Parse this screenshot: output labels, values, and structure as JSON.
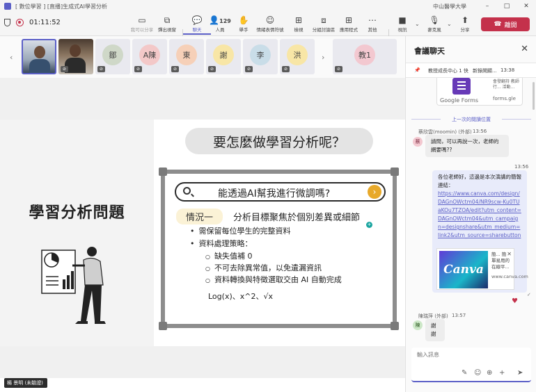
{
  "window": {
    "title": "[ 數位學習 ] [直播]生成式AI學習分析",
    "org": "中山醫學大學",
    "controls": [
      "–",
      "□",
      "✕"
    ]
  },
  "toolbar": {
    "timer": "01:11:52",
    "buttons": [
      {
        "id": "dont-disturb",
        "label": "我可以分享",
        "icon": "▭"
      },
      {
        "id": "popout",
        "label": "彈出視窗",
        "icon": "⧉"
      },
      {
        "id": "chat",
        "label": "聊天",
        "icon": "💬"
      },
      {
        "id": "people",
        "label": "人員",
        "icon": "👤",
        "count": "129"
      },
      {
        "id": "raise",
        "label": "舉手",
        "icon": "✋"
      },
      {
        "id": "react",
        "label": "情緒表情符號",
        "icon": "☺"
      },
      {
        "id": "view",
        "label": "檢視",
        "icon": "⊞"
      },
      {
        "id": "breakout",
        "label": "分組討論區",
        "icon": "⧈"
      },
      {
        "id": "apps",
        "label": "應用程式",
        "icon": "⊞"
      },
      {
        "id": "more",
        "label": "其他",
        "icon": "⋯"
      },
      {
        "id": "camera",
        "label": "視訊",
        "icon": "■"
      },
      {
        "id": "mic",
        "label": "麥克風",
        "icon": "🎙"
      },
      {
        "id": "share",
        "label": "分享",
        "icon": "⬆"
      }
    ],
    "leave_label": "離開"
  },
  "participants": [
    {
      "type": "video",
      "name": "video-participant-1"
    },
    {
      "type": "video",
      "name": "video-participant-2"
    },
    {
      "type": "avatar",
      "initials": "鄒",
      "color": "#cfd8c8"
    },
    {
      "type": "avatar",
      "initials": "A陳",
      "color": "#f3c8c8"
    },
    {
      "type": "avatar",
      "initials": "東",
      "color": "#f6d0b8"
    },
    {
      "type": "avatar",
      "initials": "謝",
      "color": "#f8e6a6"
    },
    {
      "type": "avatar",
      "initials": "李",
      "color": "#c9dde8"
    },
    {
      "type": "avatar",
      "initials": "洪",
      "color": "#f8e6a6"
    },
    {
      "type": "avatar",
      "initials": "教1",
      "color": "#f3c8d0"
    }
  ],
  "slide": {
    "left_heading": "學習分析問題",
    "question": "要怎麼做學習分析呢？",
    "search_text": "能透過AI幫我進行微調嗎?",
    "case_label": "情況一",
    "case_text": "分析目標聚焦於個別差異或細節",
    "bullets": [
      {
        "level": 1,
        "text": "需保留每位學生的完整資料"
      },
      {
        "level": 1,
        "text": "資料處理策略："
      },
      {
        "level": 2,
        "text": "缺失值補 0"
      },
      {
        "level": 2,
        "text": "不可去除異常值，以免遺漏資訊"
      },
      {
        "level": 2,
        "text": "資料轉換與特徵選取交由 AI 自動完成"
      }
    ],
    "formula": "Log(x)、x^2、√x"
  },
  "presenter_tag": "楊 景明 (未驗證)",
  "chat": {
    "title": "會議聊天",
    "close": "✕",
    "pinned": {
      "from": "教授成長中心 1 快",
      "text": "新錄開顯...",
      "time": "13:38"
    },
    "forms_card": {
      "brand": "Google Forms",
      "desc": "會發翻持 教師行... 活動...",
      "url": "forms.gle"
    },
    "last_read": "上一次的閱讀位置",
    "messages": [
      {
        "author": "蔡欣雲(moomin) (外部)",
        "time": "13:56",
        "initials": "蔡",
        "text": "請問，可以再說一次，老師的網要嗎??"
      },
      {
        "own": true,
        "time": "13:56",
        "intro": "各位老師好，這邊是本次演講的簡報連結：",
        "link": "https://www.canva.com/design/DAGnOWctm04/NR9scw-Ku0TUaKOu7TZOA/edit?utm_content=DAGnOWctm04&utm_campaign=designshare&utm_medium=link2&utm_source=sharebutton"
      },
      {
        "author": "陳瑞萍 (外部)",
        "time": "13:57",
        "initials": "陳",
        "text": "謝謝"
      }
    ],
    "link_preview": {
      "logo": "Canva",
      "title": "簡... 簡單易用的在線平...",
      "url": "www.canva.com",
      "close": "✕"
    },
    "reaction": "♥",
    "compose_placeholder": "輸入訊息",
    "compose_icons": [
      "✎",
      "☺",
      "⊕",
      "+",
      "➤"
    ]
  },
  "colors": {
    "accent": "#5b5fc7",
    "leave": "#c4314b",
    "forms": "#673ab7"
  }
}
